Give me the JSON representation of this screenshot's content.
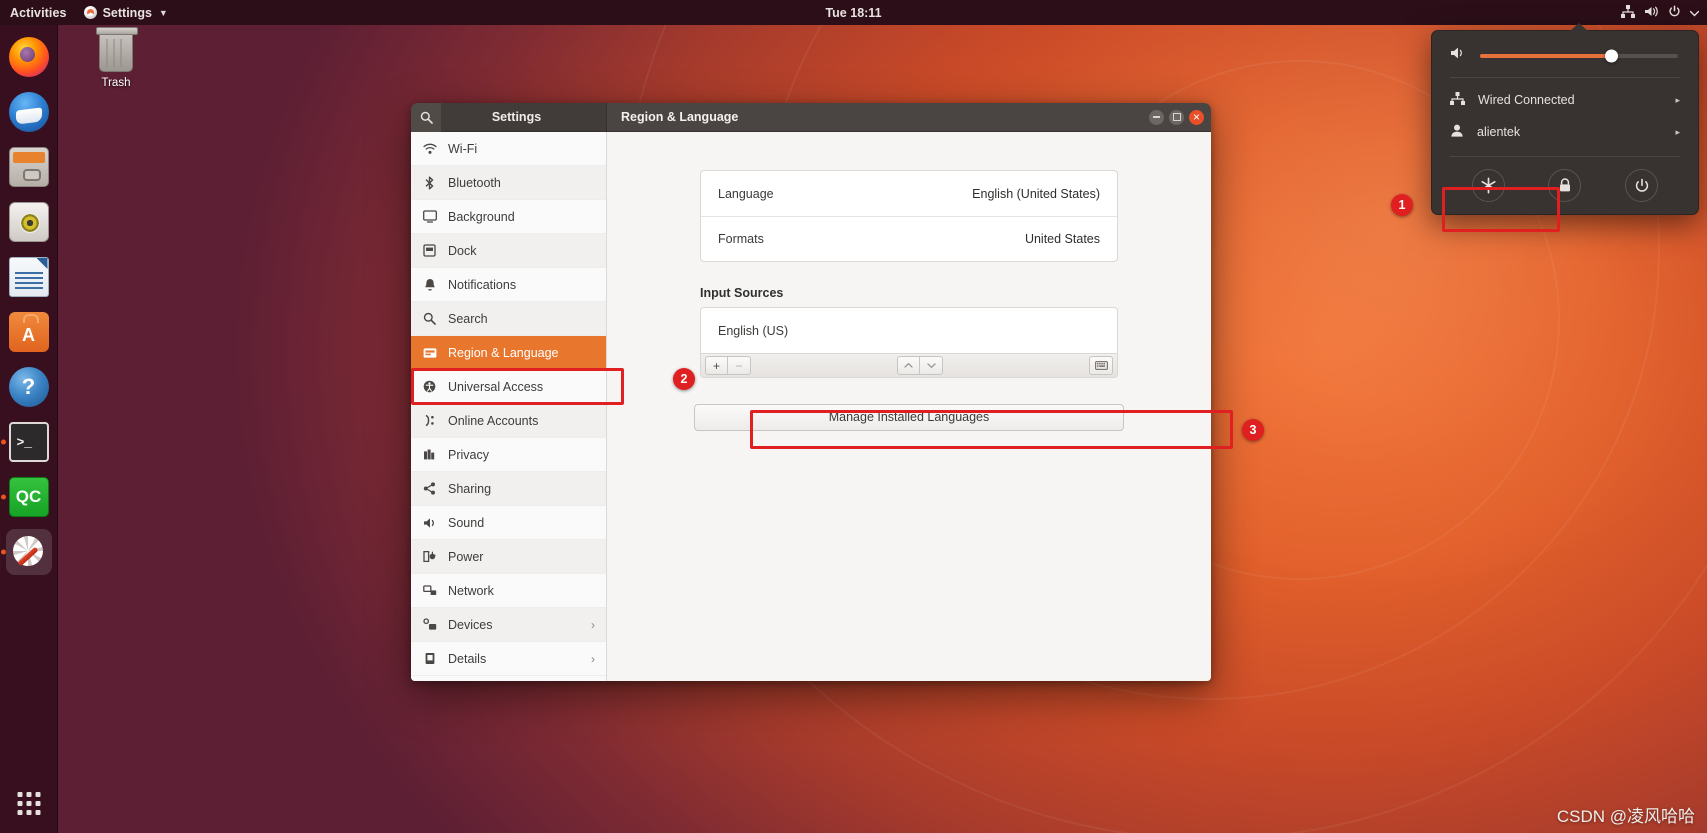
{
  "topbar": {
    "activities": "Activities",
    "app_name": "Settings",
    "app_icon": "ubuntu-settings-icon",
    "caret_icon": "chevron-down-icon",
    "clock": "Tue 18:11",
    "indicators": [
      {
        "name": "network-wired-icon"
      },
      {
        "name": "volume-icon"
      },
      {
        "name": "power-icon"
      },
      {
        "name": "chevron-down-icon"
      }
    ]
  },
  "dock": {
    "items": [
      {
        "label": "Firefox Web Browser",
        "icon": "firefox-icon",
        "running": false,
        "active": false
      },
      {
        "label": "Thunderbird Mail",
        "icon": "thunderbird-icon",
        "running": false,
        "active": false
      },
      {
        "label": "Files",
        "icon": "files-icon",
        "running": false,
        "active": false
      },
      {
        "label": "Rhythmbox",
        "icon": "rhythmbox-icon",
        "running": false,
        "active": false
      },
      {
        "label": "LibreOffice Writer",
        "icon": "libreoffice-writer-icon",
        "running": false,
        "active": false
      },
      {
        "label": "Ubuntu Software",
        "icon": "ubuntu-software-icon",
        "running": false,
        "active": false
      },
      {
        "label": "Help",
        "icon": "help-icon",
        "running": false,
        "active": false
      },
      {
        "label": "Terminal",
        "icon": "terminal-icon",
        "running": true,
        "active": false
      },
      {
        "label": "QC",
        "icon": "qc-icon",
        "running": true,
        "active": false
      },
      {
        "label": "Settings",
        "icon": "settings-gear-icon",
        "running": true,
        "active": true
      }
    ],
    "show_apps_label": "Show Applications"
  },
  "desktop": {
    "trash_label": "Trash",
    "trash_icon": "trash-icon"
  },
  "window": {
    "sidebar_title": "Settings",
    "title": "Region & Language",
    "search_icon": "search-icon",
    "controls": [
      {
        "name": "minimize-button",
        "glyph": "minimize-icon"
      },
      {
        "name": "maximize-button",
        "glyph": "maximize-icon"
      },
      {
        "name": "close-button",
        "glyph": "close-icon"
      }
    ]
  },
  "sidebar": {
    "items": [
      {
        "label": "Wi-Fi",
        "icon": "wifi-icon",
        "selected": false,
        "chevron": false
      },
      {
        "label": "Bluetooth",
        "icon": "bluetooth-icon",
        "selected": false,
        "chevron": false
      },
      {
        "label": "Background",
        "icon": "background-icon",
        "selected": false,
        "chevron": false
      },
      {
        "label": "Dock",
        "icon": "dock-icon",
        "selected": false,
        "chevron": false
      },
      {
        "label": "Notifications",
        "icon": "notifications-bell-icon",
        "selected": false,
        "chevron": false
      },
      {
        "label": "Search",
        "icon": "search-icon",
        "selected": false,
        "chevron": false
      },
      {
        "label": "Region & Language",
        "icon": "region-language-icon",
        "selected": true,
        "chevron": false
      },
      {
        "label": "Universal Access",
        "icon": "universal-access-icon",
        "selected": false,
        "chevron": false
      },
      {
        "label": "Online Accounts",
        "icon": "online-accounts-icon",
        "selected": false,
        "chevron": false
      },
      {
        "label": "Privacy",
        "icon": "privacy-icon",
        "selected": false,
        "chevron": false
      },
      {
        "label": "Sharing",
        "icon": "sharing-icon",
        "selected": false,
        "chevron": false
      },
      {
        "label": "Sound",
        "icon": "sound-icon",
        "selected": false,
        "chevron": false
      },
      {
        "label": "Power",
        "icon": "power-plug-icon",
        "selected": false,
        "chevron": false
      },
      {
        "label": "Network",
        "icon": "network-icon",
        "selected": false,
        "chevron": false
      },
      {
        "label": "Devices",
        "icon": "devices-icon",
        "selected": false,
        "chevron": true
      },
      {
        "label": "Details",
        "icon": "details-icon",
        "selected": false,
        "chevron": true
      }
    ],
    "chevron_glyph": "›"
  },
  "content": {
    "rows": [
      {
        "label": "Language",
        "value": "English (United States)"
      },
      {
        "label": "Formats",
        "value": "United States"
      }
    ],
    "input_sources_title": "Input Sources",
    "input_sources": [
      {
        "label": "English (US)"
      }
    ],
    "toolbar": {
      "add_label": "+",
      "remove_label": "−",
      "move_up_label": "⌃",
      "move_down_label": "⌄",
      "keyboard_icon": "keyboard-icon"
    },
    "manage_button": "Manage Installed Languages"
  },
  "system_menu": {
    "volume": {
      "icon": "volume-icon",
      "level": 66
    },
    "rows": [
      {
        "label": "Wired Connected",
        "icon": "network-wired-icon",
        "arrow": "▸"
      },
      {
        "label": "alientek",
        "icon": "user-icon",
        "arrow": "▸"
      }
    ],
    "actions": [
      {
        "name": "settings-button",
        "icon": "settings-tools-icon"
      },
      {
        "name": "lock-button",
        "icon": "lock-icon"
      },
      {
        "name": "power-off-button",
        "icon": "power-icon"
      }
    ]
  },
  "annotations": [
    {
      "number": "1",
      "target": "system-menu-settings-button"
    },
    {
      "number": "2",
      "target": "sidebar-item-region-language"
    },
    {
      "number": "3",
      "target": "manage-installed-languages-button"
    }
  ],
  "watermark": "CSDN @凌风哈哈",
  "colors": {
    "accent_orange": "#e8762d",
    "annotation_red": "#e02020",
    "topbar_bg": "#2b0e18",
    "window_header": "#4a4543",
    "close_button": "#e8502a"
  }
}
